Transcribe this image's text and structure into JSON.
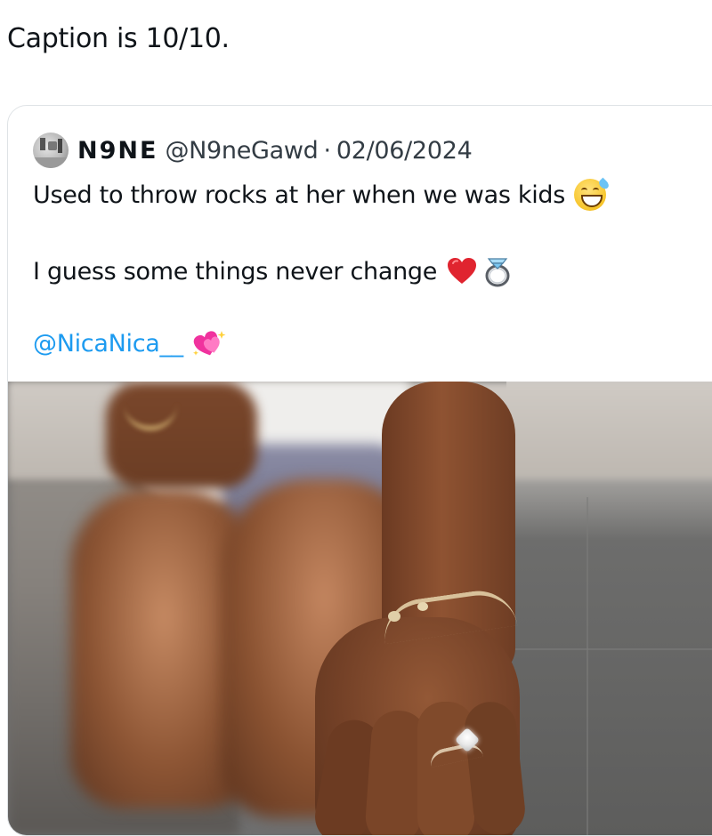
{
  "post": {
    "caption": "Caption is 10/10."
  },
  "quote": {
    "author": {
      "display_name": "N9NE",
      "handle": "@N9neGawd",
      "separator": "·",
      "date": "02/06/2024"
    },
    "lines": [
      "Used to throw rocks at her when we was kids",
      "I guess some things never change",
      "@NicaNica__"
    ],
    "emojis": {
      "line1": [
        "grinning-face-with-sweat-icon"
      ],
      "line2": [
        "red-heart-icon",
        "ring-icon"
      ],
      "line3": [
        "sparkling-heart-icon"
      ]
    },
    "accent_link_color": "#1d9bf0"
  }
}
